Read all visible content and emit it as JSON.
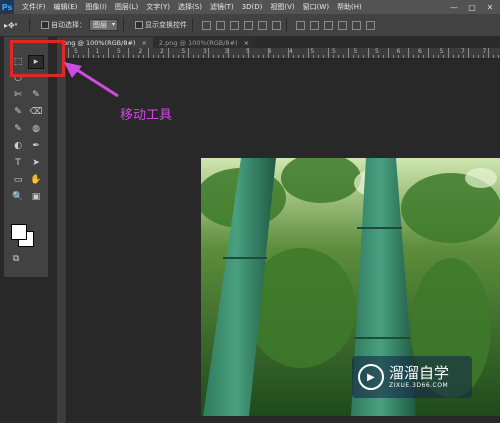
{
  "app": {
    "logo": "Ps"
  },
  "menu": [
    "文件(F)",
    "编辑(E)",
    "图像(I)",
    "图层(L)",
    "文字(Y)",
    "选择(S)",
    "滤镜(T)",
    "3D(D)",
    "视图(V)",
    "窗口(W)",
    "帮助(H)"
  ],
  "window_controls": {
    "minimize": "—",
    "maximize": "□",
    "close": "✕"
  },
  "options_bar": {
    "tool_icon": "move-tool-icon",
    "auto_select_label": "自动选择：",
    "auto_select_value": "图层",
    "show_transform_label": "显示变换控件"
  },
  "tabs": [
    {
      "label": "png @ 100%(RGB/8#)",
      "close": "×",
      "active": true
    },
    {
      "label": "2.png @ 100%(RGB/8#)",
      "close": "×",
      "active": false
    }
  ],
  "ruler": {
    "h_labels": [
      "5",
      "1",
      "5",
      "2",
      "2",
      "5",
      "3",
      "3",
      "5",
      "4",
      "4",
      "5",
      "5",
      "5",
      "5",
      "6",
      "6",
      "5",
      "7",
      "7"
    ]
  },
  "toolbox": {
    "move_tool_icon": "▸",
    "tools": [
      "⬚",
      "○",
      "✄",
      "✎",
      "✎",
      "⌫",
      "✎",
      "◍",
      "◐",
      "✒",
      "T",
      "➤",
      "▭",
      "✋",
      "🔍",
      "▣",
      "⧉"
    ]
  },
  "annotation": {
    "label": "移动工具",
    "color": "#d04be0"
  },
  "watermark": {
    "title": "溜溜自学",
    "url": "ZIXUE.3D66.COM"
  }
}
